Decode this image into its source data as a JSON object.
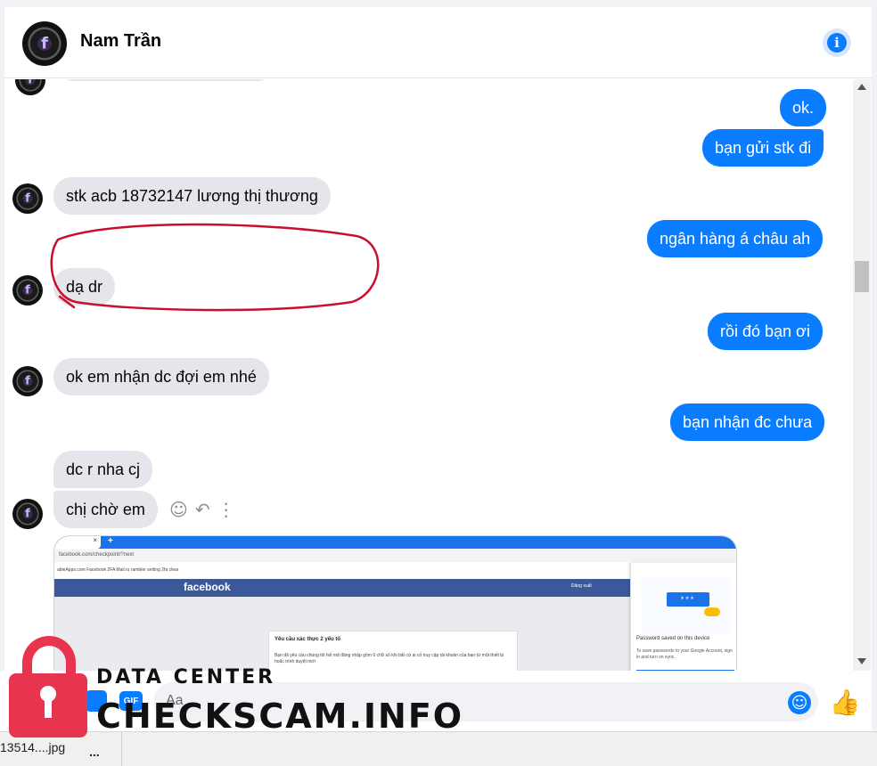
{
  "header": {
    "contact_name": "Nam Trần",
    "info_icon": "info-icon"
  },
  "messages": [
    {
      "side": "out",
      "text": "ok."
    },
    {
      "side": "out",
      "text": "bạn gửi stk đi"
    },
    {
      "side": "in",
      "text": "stk acb 18732147 lương thị thương",
      "highlighted": true
    },
    {
      "side": "out",
      "text": "ngân hàng á châu ah"
    },
    {
      "side": "in",
      "text": "dạ dr"
    },
    {
      "side": "out",
      "text": "rồi đó bạn ơi"
    },
    {
      "side": "in",
      "text": "ok em nhận dc đợi em nhé"
    },
    {
      "side": "out",
      "text": "bạn nhận đc chưa"
    },
    {
      "side": "in",
      "text": "dc r nha cj"
    },
    {
      "side": "in",
      "text": "chị chờ em"
    }
  ],
  "message_actions": [
    "smile-icon",
    "reply-icon",
    "more-icon"
  ],
  "attachment": {
    "url": "facebook.com/checkpoint/?next",
    "bookmarks": "ableApps.com   Facebook   2FA   Mail.ru   rambler   setting   2fa   clear",
    "brand": "facebook",
    "logout": "Đăng xuất",
    "card_title": "Yêu cầu xác thực 2 yếu tố",
    "card_text": "Bạn đã yêu cầu chúng tôi hỏi mã đăng nhập gồm 6 chữ số khi bất cứ ai cố truy cập tài khoản của bạn từ một thiết bị hoặc trình duyệt mới",
    "pw_dots": "***",
    "pw_title": "Password saved on this device",
    "pw_text": "To save passwords to your Google Account, sign in and turn on sync."
  },
  "composer": {
    "placeholder": "Aa",
    "gif_label": "GIF"
  },
  "download": {
    "file_name": "13514....jpg",
    "more": "..."
  },
  "watermark": {
    "line1": "DATA CENTER",
    "line2": "CHECKSCAM.INFO"
  },
  "colors": {
    "outgoing_bubble": "#0a7cff",
    "incoming_bubble": "#e4e6eb",
    "annotation": "#c8102e",
    "watermark_lock": "#e8354f"
  }
}
